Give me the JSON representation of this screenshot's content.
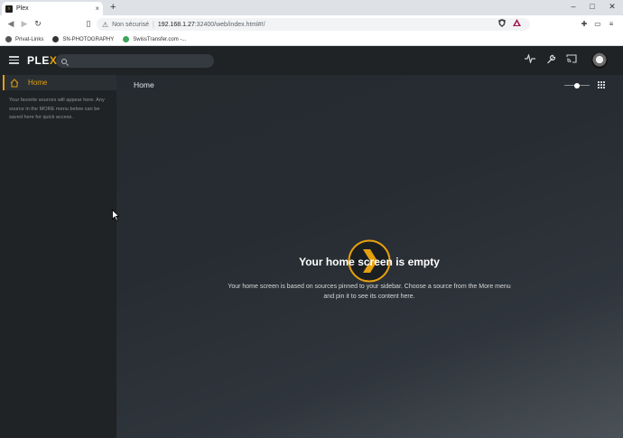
{
  "browser": {
    "tab_title": "Plex",
    "tab_close": "×",
    "new_tab": "+",
    "window_controls": {
      "minimize": "–",
      "maximize": "□",
      "close": "✕"
    },
    "nav": {
      "back": "◀",
      "forward": "▶",
      "reload": "↻"
    },
    "address": {
      "security_icon": "warning-icon",
      "insecure_label": "Non sécurisé",
      "separator": "|",
      "url_host": "192.168.1.27",
      "url_path": ":32400/web/index.html#!/"
    },
    "bookmarks": [
      {
        "label": "Privat-Links",
        "color": "#555555"
      },
      {
        "label": "SN-PHOTOGRAPHY",
        "color": "#333333"
      },
      {
        "label": "SwissTransfer.com -...",
        "color": "#3ea55b"
      }
    ]
  },
  "plex": {
    "logo_main": "PLE",
    "logo_x": "X",
    "search": {
      "placeholder": ""
    },
    "accent_color": "#e5a00d",
    "sidebar": {
      "home_label": "Home",
      "note": "Your favorite sources will appear here. Any source in the MORE menu below can be saved here for quick access."
    },
    "main": {
      "heading": "Home",
      "empty_title": "Your home screen is empty",
      "empty_description": "Your home screen is based on sources pinned to your sidebar. Choose a source from the More menu and pin it to see its content here."
    }
  }
}
